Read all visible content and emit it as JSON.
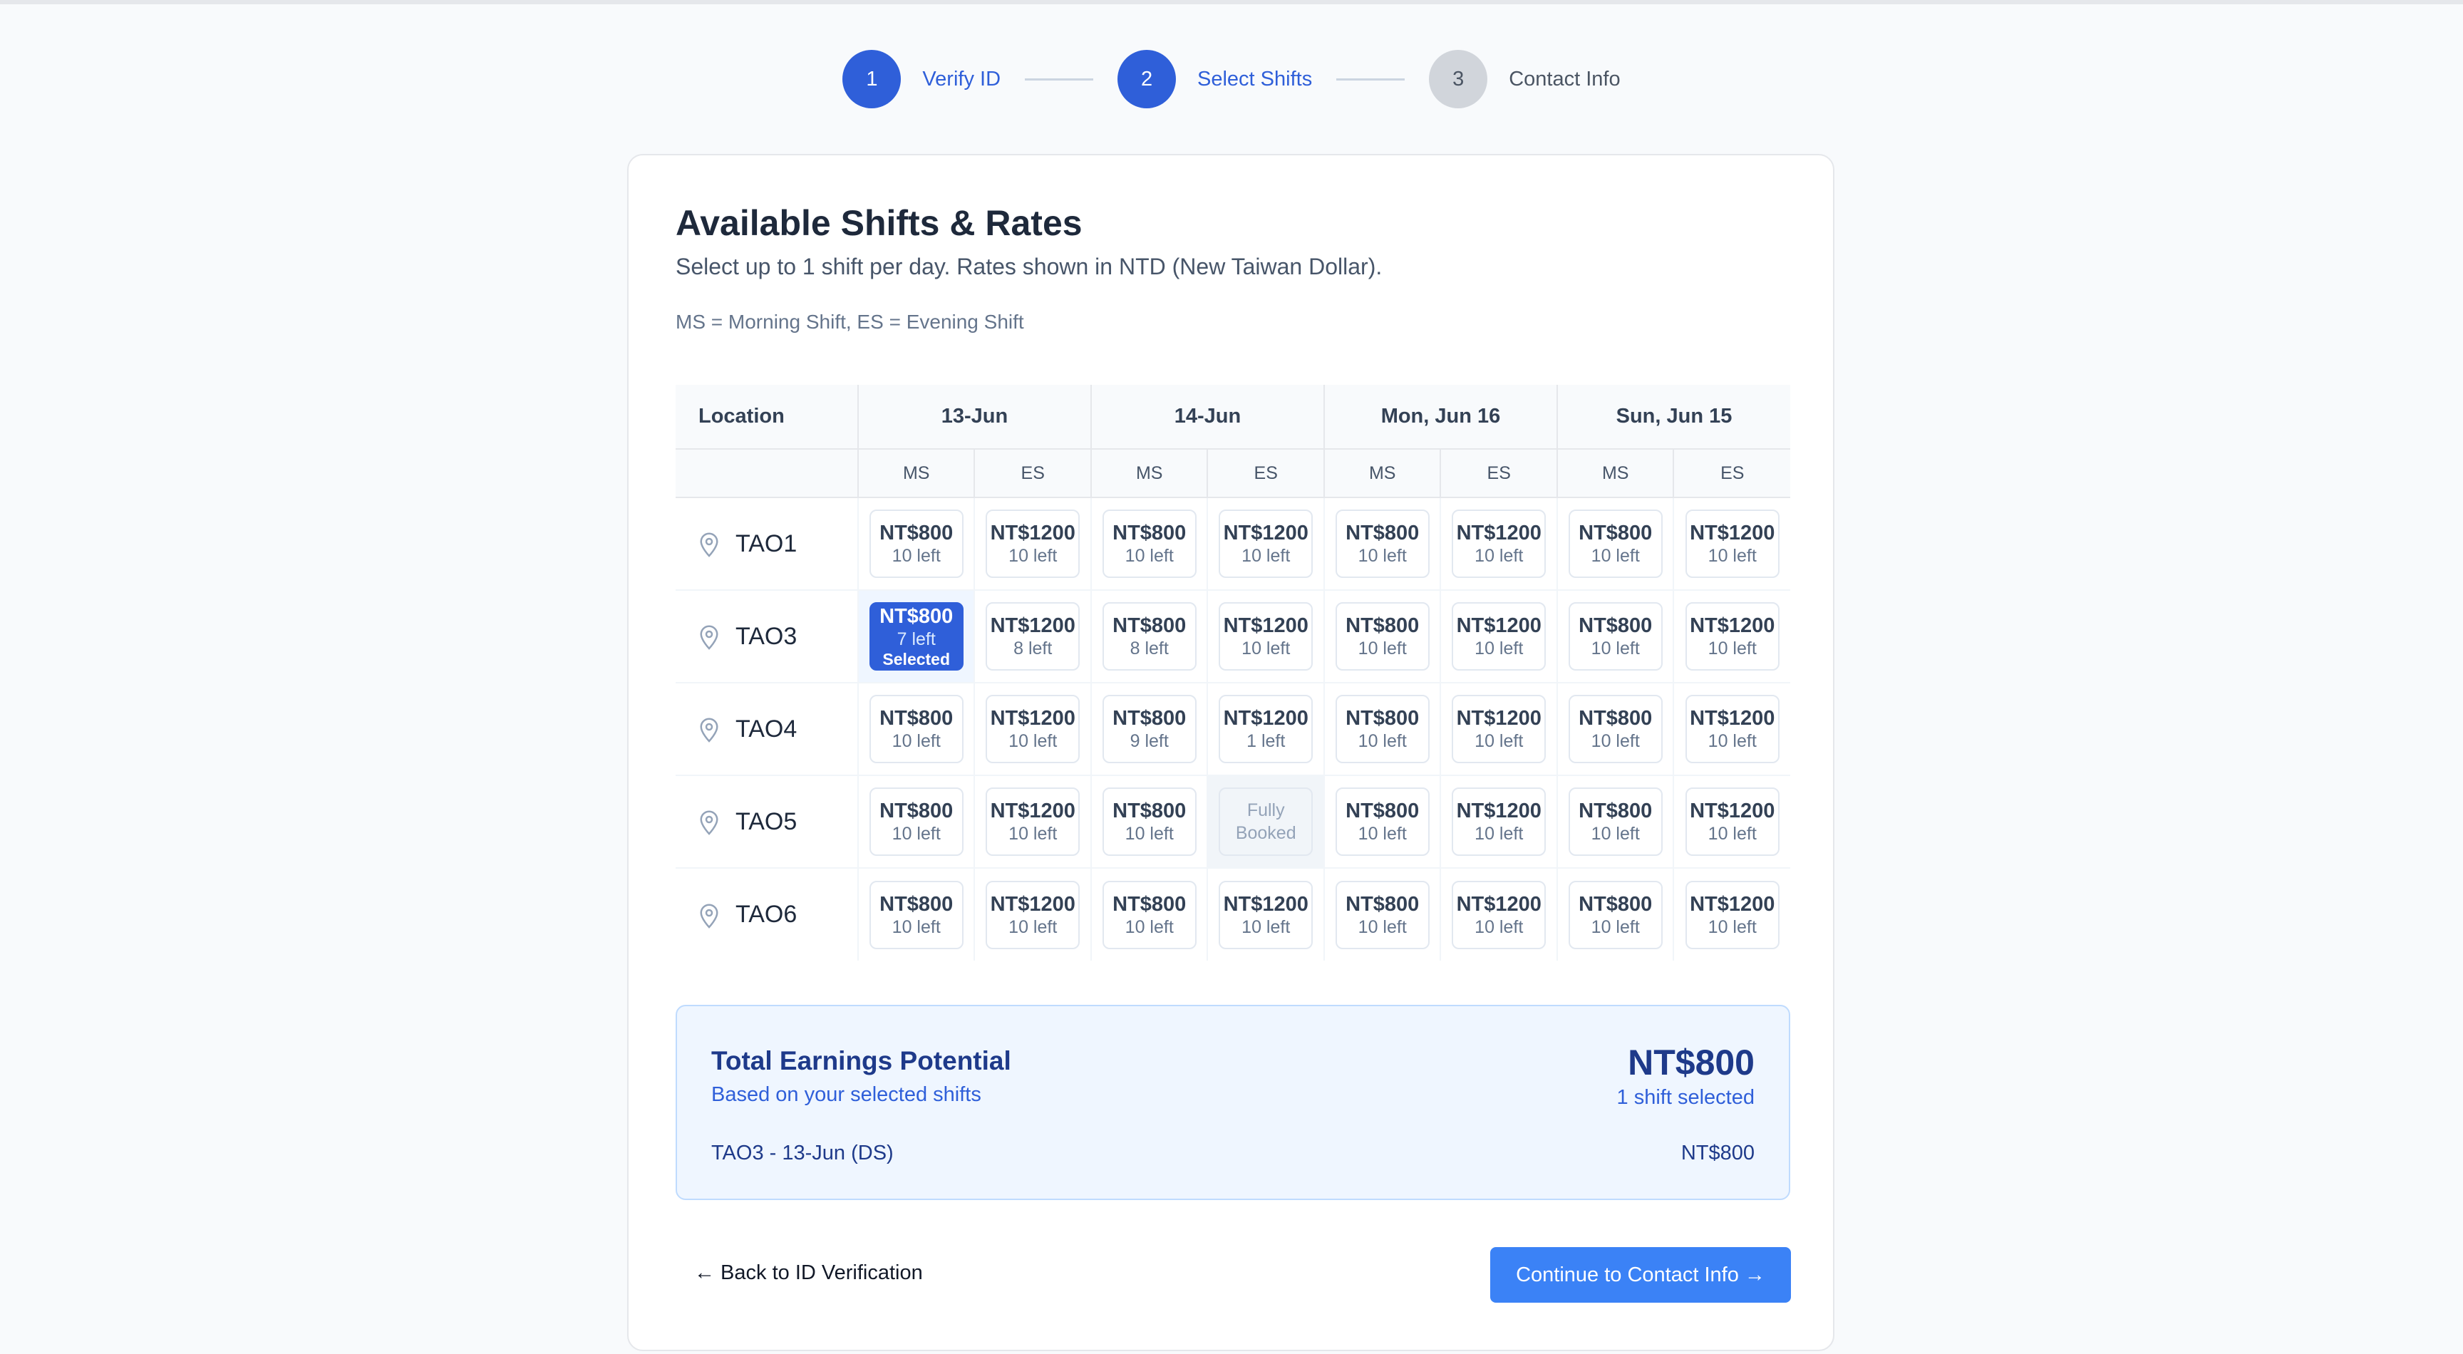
{
  "stepper": [
    {
      "number": "1",
      "label": "Verify ID",
      "state": "complete"
    },
    {
      "number": "2",
      "label": "Select Shifts",
      "state": "active"
    },
    {
      "number": "3",
      "label": "Contact Info",
      "state": "inactive"
    }
  ],
  "card": {
    "title": "Available Shifts & Rates",
    "subtitle": "Select up to 1 shift per day. Rates shown in NTD (New Taiwan Dollar).",
    "legend": "MS = Morning Shift, ES = Evening Shift"
  },
  "table": {
    "location_header": "Location",
    "dates": [
      "13-Jun",
      "14-Jun",
      "Mon, Jun 16",
      "Sun, Jun 15"
    ],
    "shift_labels": [
      "MS",
      "ES"
    ],
    "selected_tag": "Selected",
    "booked_line1": "Fully",
    "booked_line2": "Booked",
    "rows": [
      {
        "location": "TAO1",
        "cells": [
          {
            "rate": "NT$800",
            "left": "10 left"
          },
          {
            "rate": "NT$1200",
            "left": "10 left"
          },
          {
            "rate": "NT$800",
            "left": "10 left"
          },
          {
            "rate": "NT$1200",
            "left": "10 left"
          },
          {
            "rate": "NT$800",
            "left": "10 left"
          },
          {
            "rate": "NT$1200",
            "left": "10 left"
          },
          {
            "rate": "NT$800",
            "left": "10 left"
          },
          {
            "rate": "NT$1200",
            "left": "10 left"
          }
        ]
      },
      {
        "location": "TAO3",
        "cells": [
          {
            "rate": "NT$800",
            "left": "7 left",
            "selected": true
          },
          {
            "rate": "NT$1200",
            "left": "8 left"
          },
          {
            "rate": "NT$800",
            "left": "8 left"
          },
          {
            "rate": "NT$1200",
            "left": "10 left"
          },
          {
            "rate": "NT$800",
            "left": "10 left"
          },
          {
            "rate": "NT$1200",
            "left": "10 left"
          },
          {
            "rate": "NT$800",
            "left": "10 left"
          },
          {
            "rate": "NT$1200",
            "left": "10 left"
          }
        ]
      },
      {
        "location": "TAO4",
        "cells": [
          {
            "rate": "NT$800",
            "left": "10 left"
          },
          {
            "rate": "NT$1200",
            "left": "10 left"
          },
          {
            "rate": "NT$800",
            "left": "9 left"
          },
          {
            "rate": "NT$1200",
            "left": "1 left"
          },
          {
            "rate": "NT$800",
            "left": "10 left"
          },
          {
            "rate": "NT$1200",
            "left": "10 left"
          },
          {
            "rate": "NT$800",
            "left": "10 left"
          },
          {
            "rate": "NT$1200",
            "left": "10 left"
          }
        ]
      },
      {
        "location": "TAO5",
        "cells": [
          {
            "rate": "NT$800",
            "left": "10 left"
          },
          {
            "rate": "NT$1200",
            "left": "10 left"
          },
          {
            "rate": "NT$800",
            "left": "10 left"
          },
          {
            "booked": true
          },
          {
            "rate": "NT$800",
            "left": "10 left"
          },
          {
            "rate": "NT$1200",
            "left": "10 left"
          },
          {
            "rate": "NT$800",
            "left": "10 left"
          },
          {
            "rate": "NT$1200",
            "left": "10 left"
          }
        ]
      },
      {
        "location": "TAO6",
        "cells": [
          {
            "rate": "NT$800",
            "left": "10 left"
          },
          {
            "rate": "NT$1200",
            "left": "10 left"
          },
          {
            "rate": "NT$800",
            "left": "10 left"
          },
          {
            "rate": "NT$1200",
            "left": "10 left"
          },
          {
            "rate": "NT$800",
            "left": "10 left"
          },
          {
            "rate": "NT$1200",
            "left": "10 left"
          },
          {
            "rate": "NT$800",
            "left": "10 left"
          },
          {
            "rate": "NT$1200",
            "left": "10 left"
          }
        ]
      }
    ]
  },
  "earnings": {
    "title": "Total Earnings Potential",
    "subtitle": "Based on your selected shifts",
    "total": "NT$800",
    "count": "1 shift selected",
    "items": [
      {
        "label": "TAO3 - 13-Jun (DS)",
        "value": "NT$800"
      }
    ]
  },
  "actions": {
    "back_label": "← Back to ID Verification",
    "continue_label": "Continue to Contact Info →"
  },
  "colors": {
    "primary": "#2f5fd9",
    "button": "#3b82f6",
    "earnings_bg": "#eff6ff"
  }
}
